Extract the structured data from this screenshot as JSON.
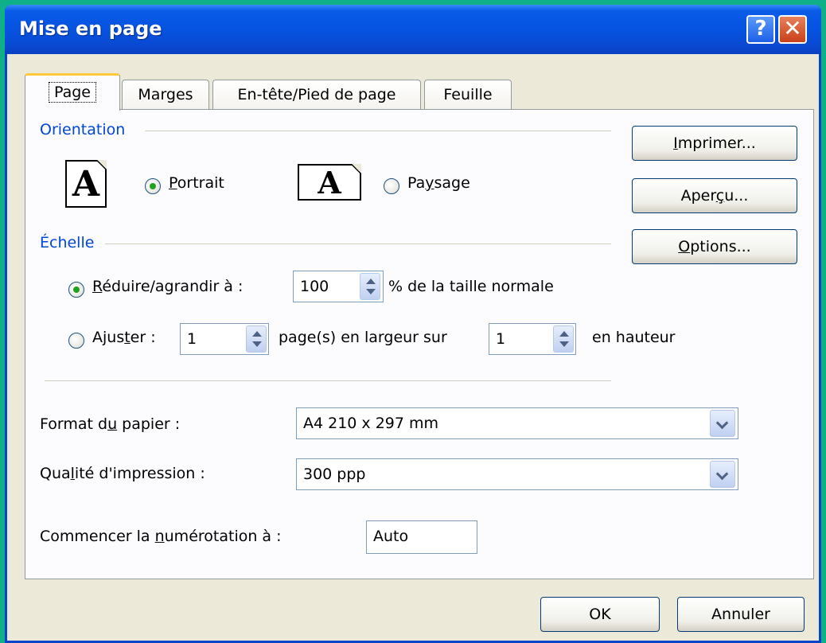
{
  "window": {
    "title": "Mise en page"
  },
  "titlebar": {
    "help_glyph": "?",
    "close_glyph": "✕"
  },
  "tabs": [
    {
      "label": "Page",
      "active": true
    },
    {
      "label": "Marges",
      "active": false
    },
    {
      "label": "En-tête/Pied de page",
      "active": false
    },
    {
      "label": "Feuille",
      "active": false
    }
  ],
  "orientation": {
    "group_label": "Orientation",
    "icon_glyph": "A",
    "portrait_label": "Portrait",
    "landscape_label": "Paysage",
    "selected": "portrait"
  },
  "side_buttons": {
    "print": "Imprimer...",
    "preview": "Aperçu...",
    "options": "Options..."
  },
  "scale": {
    "group_label": "Échelle",
    "reduce_label": "Réduire/agrandir à :",
    "reduce_value": "100",
    "reduce_suffix": "% de la taille normale",
    "fit_label": "Ajuster :",
    "fit_width_value": "1",
    "fit_width_suffix": "page(s) en largeur sur",
    "fit_height_value": "1",
    "fit_height_suffix": "en hauteur",
    "selected": "reduce"
  },
  "paper": {
    "format_label": "Format du papier :",
    "format_value": "A4 210 x 297 mm",
    "quality_label": "Qualité d'impression :",
    "quality_value": "300 ppp",
    "numbering_label": "Commencer la numérotation à :",
    "numbering_value": "Auto"
  },
  "footer": {
    "ok": "OK",
    "cancel": "Annuler"
  },
  "colors": {
    "background": "#0fb087",
    "titlebar": "#0553e0",
    "dialog": "#ece9d8",
    "group_label": "#0046d5",
    "radio_checked": "#21a121",
    "active_tab_accent": "#ffc83c"
  }
}
